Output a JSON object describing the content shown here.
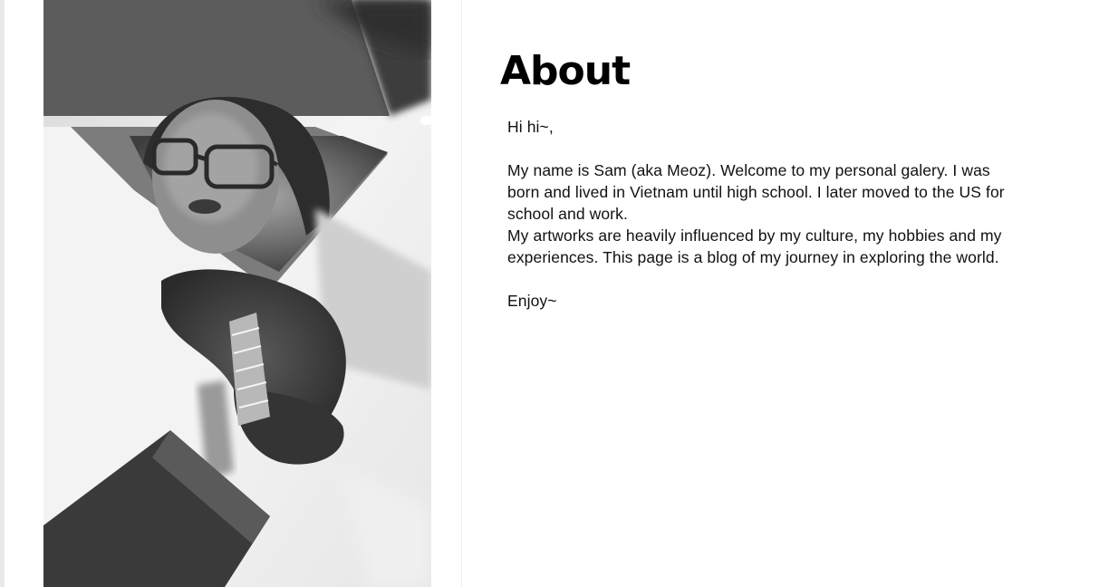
{
  "about": {
    "title": "About",
    "greeting": "Hi hi~,",
    "para1_line1": "My name is Sam (aka Meoz). Welcome to my personal galery. I was",
    "para1_line2": "born and lived in Vietnam until high school. I later moved to the US for",
    "para1_line3": "school and work.",
    "para2_line1": "My artworks are heavily influenced by my culture, my hobbies and my",
    "para2_line2": "experiences. This page is a blog of my journey in exploring the world.",
    "closing": "Enjoy~"
  },
  "photo": {
    "style": "black-and-white portrait reflected in angular mirror shards",
    "colors": {
      "light": "#f2f2f2",
      "mid": "#9a9a9a",
      "dark": "#3a3a3a"
    }
  }
}
